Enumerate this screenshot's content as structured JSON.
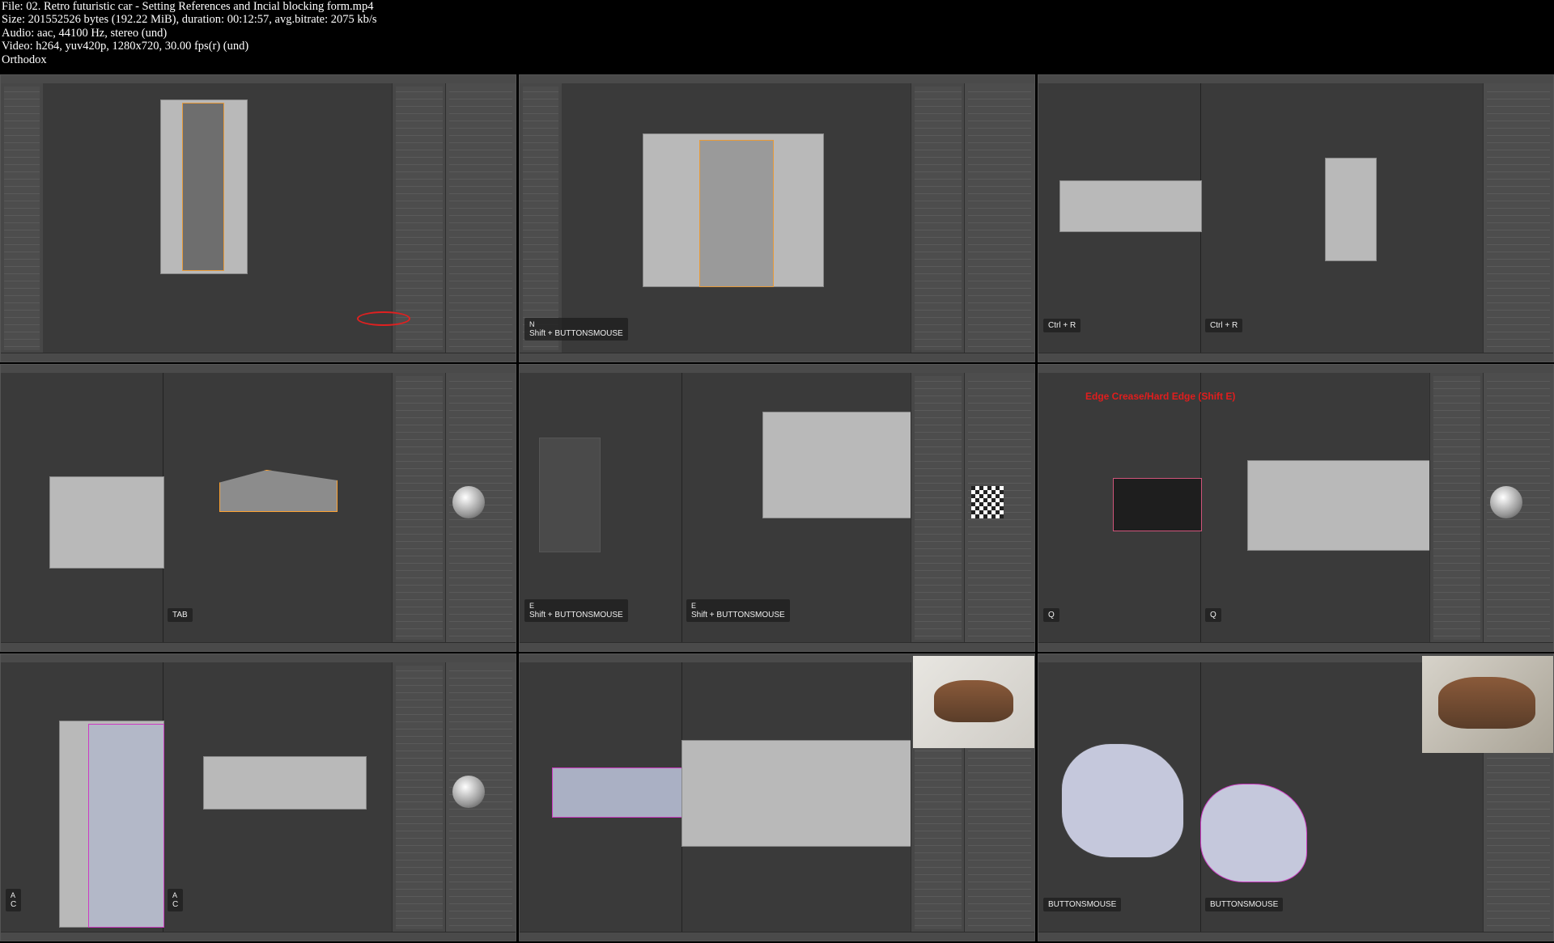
{
  "meta": {
    "file": "File: 02. Retro futuristic car - Setting References and Incial blocking form.mp4",
    "size": "Size: 201552526 bytes (192.22 MiB), duration: 00:12:57, avg.bitrate: 2075 kb/s",
    "audio": "Audio: aac, 44100 Hz, stereo (und)",
    "video": "Video: h264, yuv420p, 1280x720, 30.00 fps(r) (und)",
    "tag": "Orthodox"
  },
  "tiles": [
    {
      "id": 1,
      "hints": []
    },
    {
      "id": 2,
      "hints": [
        {
          "key": "N",
          "action": "Shift + BUTTONSMOUSE"
        }
      ]
    },
    {
      "id": 3,
      "hints": [
        {
          "key": "",
          "action": "Ctrl + R"
        },
        {
          "key": "",
          "action": "Ctrl + R"
        }
      ]
    },
    {
      "id": 4,
      "hints": [
        {
          "key": "",
          "action": "TAB"
        }
      ]
    },
    {
      "id": 5,
      "hints": [
        {
          "key": "E",
          "action": "Shift + BUTTONSMOUSE"
        },
        {
          "key": "E",
          "action": "Shift + BUTTONSMOUSE"
        }
      ]
    },
    {
      "id": 6,
      "overlay": "Edge Crease/Hard Edge (Shift E)",
      "hints": [
        {
          "key": "",
          "action": "Q"
        },
        {
          "key": "",
          "action": "Q"
        }
      ]
    },
    {
      "id": 7,
      "hints": [
        {
          "key": "A",
          "action": "C"
        },
        {
          "key": "A",
          "action": "C"
        }
      ]
    },
    {
      "id": 8,
      "hints": []
    },
    {
      "id": 9,
      "hints": [
        {
          "key": "",
          "action": "BUTTONSMOUSE"
        },
        {
          "key": "",
          "action": "BUTTONSMOUSE"
        }
      ]
    }
  ],
  "colors": {
    "background": "#000000",
    "viewport": "#3a3a3a",
    "panel": "#474747",
    "selection": "#ffa433",
    "accent_red": "#e21d1d",
    "blender_blue": "#5680c2"
  }
}
